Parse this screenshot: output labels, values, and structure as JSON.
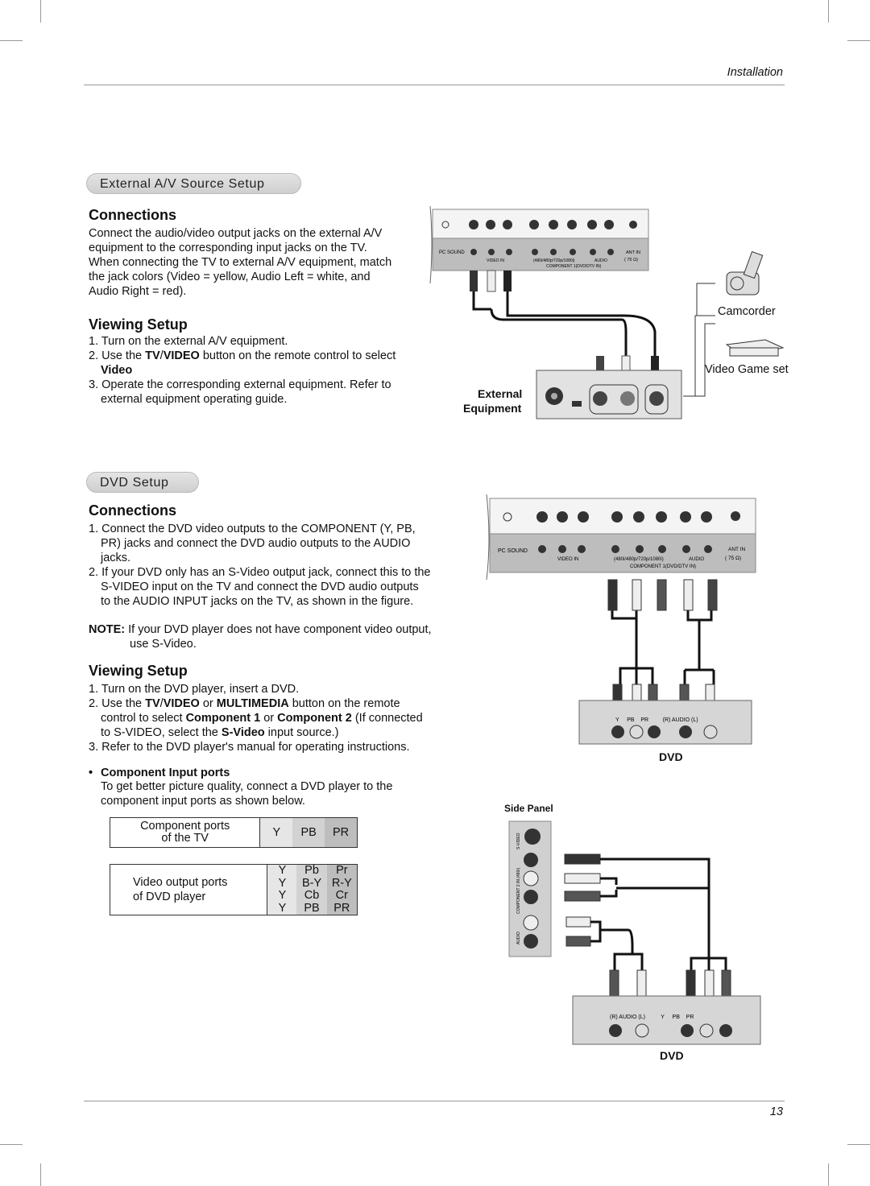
{
  "header": {
    "section": "Installation"
  },
  "page_number": "13",
  "external_av": {
    "title": "External A/V Source Setup",
    "connections": {
      "heading": "Connections",
      "text": "Connect the audio/video output jacks on the external A/V equipment to the corresponding input jacks on the TV. When connecting the TV to external A/V equipment, match the jack colors (Video = yellow, Audio Left = white, and Audio Right = red)."
    },
    "viewing": {
      "heading": "Viewing Setup",
      "step1": "1. Turn on the external A/V equipment.",
      "step2_a": "2. Use the ",
      "step2_b": "TV",
      "step2_c": "/",
      "step2_d": "VIDEO",
      "step2_e": " button on the remote control to select ",
      "step2_f": "Video",
      ".": ".",
      "step3": "3. Operate the corresponding external equipment. Refer to external equipment operating guide."
    },
    "diagram": {
      "pc_sound": "PC SOUND",
      "video_in": "VIDEO IN",
      "resolutions": "(480i/480p/720p/1080i)",
      "component": "COMPONENT 1(DVD/DTV IN)",
      "audio": "AUDIO",
      "ant_in": "ANT IN",
      "ohm": "( 75 Ω)",
      "camcorder": "Camcorder",
      "game": "Video Game set",
      "external": "External",
      "equipment": "Equipment"
    }
  },
  "dvd": {
    "title": "DVD Setup",
    "connections": {
      "heading": "Connections",
      "step1": "1. Connect the DVD video outputs to the COMPONENT (Y, PB, PR) jacks and connect the DVD audio outputs to the AUDIO jacks.",
      "step2": "2. If your DVD only has an S-Video output jack, connect this to the S-VIDEO input on the TV and connect the DVD audio outputs to the AUDIO INPUT jacks on the TV, as shown in the figure.",
      "note_label": "NOTE:",
      "note_text": " If your DVD player does not have component video output, use S-Video."
    },
    "viewing": {
      "heading": "Viewing Setup",
      "step1": "1. Turn on the DVD player, insert a DVD.",
      "s2a": "2. Use the ",
      "s2b": "TV",
      "s2c": "/",
      "s2d": "VIDEO",
      "s2e": " or ",
      "s2f": "MULTIMEDIA",
      "s2g": " button on the remote control to select ",
      "s2h": "Component 1",
      "s2i": " or ",
      "s2j": "Component 2",
      "s2k": " (If connected to S-VIDEO, select the ",
      "s2l": "S-Video",
      "s2m": " input source.)",
      "step3": "3. Refer to the DVD player's manual for operating instructions."
    },
    "component_ports": {
      "bullet": "•",
      "heading": "Component Input ports",
      "text": "To get better picture quality, connect a DVD player to the component input ports as shown below."
    },
    "table_tv": {
      "label_1": "Component ports",
      "label_2": "of the TV",
      "y": "Y",
      "pb": "PB",
      "pr": "PR"
    },
    "table_dvd": {
      "label_1": "Video output ports",
      "label_2": "of DVD player",
      "rows": [
        [
          "Y",
          "Pb",
          "Pr"
        ],
        [
          "Y",
          "B-Y",
          "R-Y"
        ],
        [
          "Y",
          "Cb",
          "Cr"
        ],
        [
          "Y",
          "PB",
          "PR"
        ]
      ]
    },
    "diagram": {
      "pc_sound": "PC SOUND",
      "video_in": "VIDEO IN",
      "resolutions": "(480i/480p/720p/1080i)",
      "component": "COMPONENT 1(DVD/DTV IN)",
      "audio": "AUDIO",
      "ant_in": "ANT IN",
      "ohm": "( 75 Ω)",
      "dvd_labels": "Y     PB    PR         (R) AUDIO (L)",
      "dvd": "DVD",
      "side_panel": "Side Panel",
      "side_labels": {
        "svideo": "S-VIDEO",
        "component2": "COMPONENT 2 IN (480i)",
        "audio": "AUDIO"
      },
      "dvd2_labels": "(R) AUDIO (L)          Y     PB    PR",
      "dvd2": "DVD"
    }
  }
}
